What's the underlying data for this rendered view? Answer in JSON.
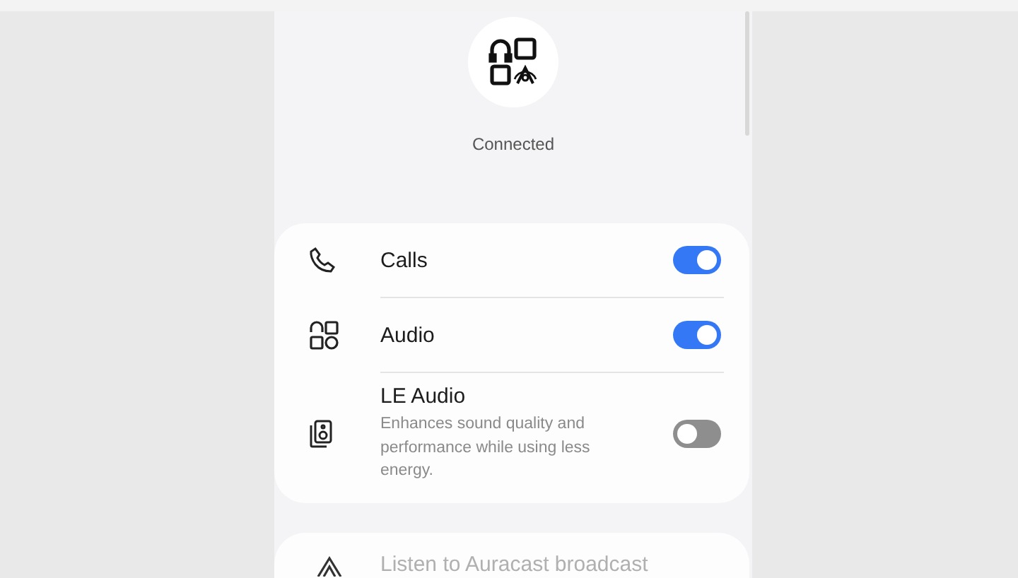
{
  "device": {
    "status": "Connected"
  },
  "settings": [
    {
      "kind": "calls",
      "label": "Calls",
      "on": true
    },
    {
      "kind": "audio",
      "label": "Audio",
      "on": true
    },
    {
      "kind": "le_audio",
      "label": "LE Audio",
      "description": "Enhances sound quality and performance while using less energy.",
      "on": false
    }
  ],
  "broadcast": {
    "label": "Listen to Auracast broadcast"
  }
}
